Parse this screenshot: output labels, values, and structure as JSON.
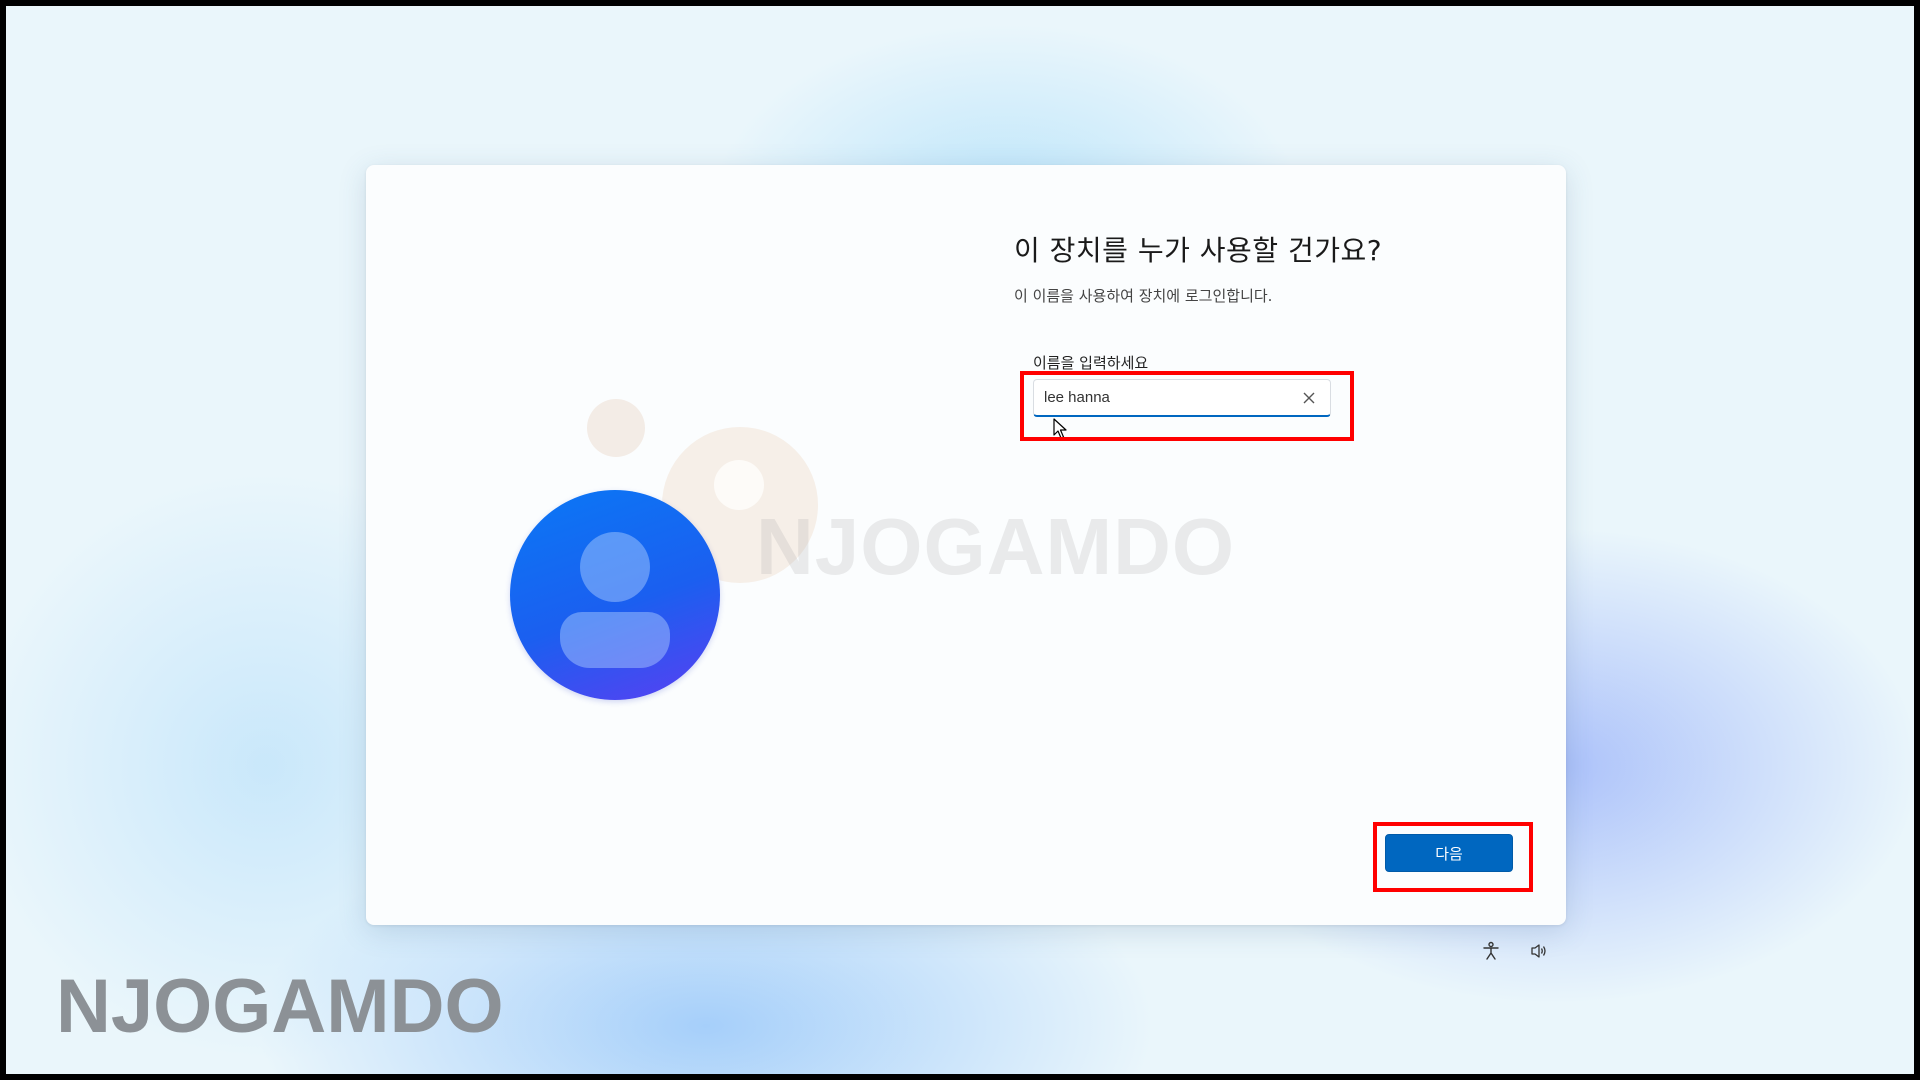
{
  "dialog": {
    "title": "이 장치를 누가 사용할 건가요?",
    "subtitle": "이 이름을 사용하여 장치에 로그인합니다.",
    "field_label": "이름을 입력하세요",
    "name_value": "lee hanna",
    "clear_icon": "close-icon",
    "next_label": "다음"
  },
  "tray": {
    "accessibility_icon": "accessibility-icon",
    "volume_icon": "volume-icon"
  },
  "watermark": {
    "center_text": "NJOGAMDO",
    "corner_text": "NJOGAMDO"
  },
  "colors": {
    "accent": "#0067c0",
    "highlight": "#ff0000"
  }
}
